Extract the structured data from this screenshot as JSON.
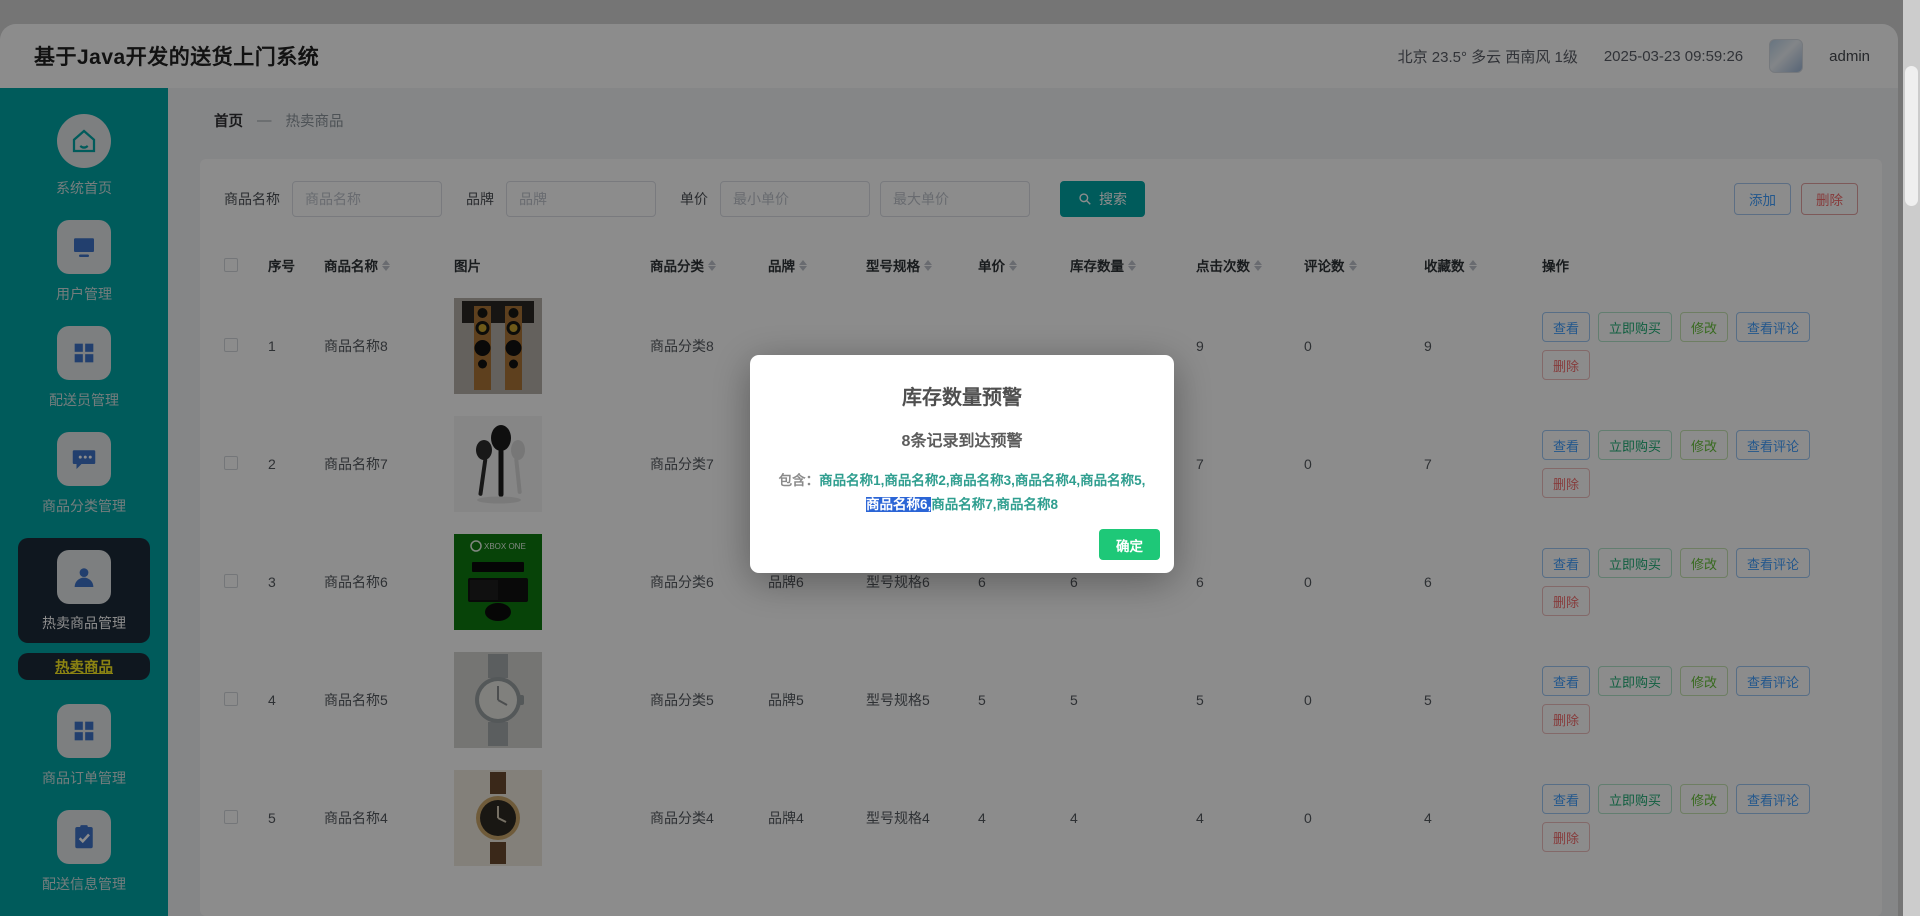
{
  "colors": {
    "teal": "#00a6a6",
    "active_bg": "#1d2a39",
    "submenu_text": "#fdee21",
    "link_blue": "#409eff",
    "danger": "#f56c6c",
    "success": "#1ec878",
    "names_teal": "#2f9e8f",
    "highlight_blue": "#2b65d6"
  },
  "app": {
    "title": "基于Java开发的送货上门系统"
  },
  "topbar": {
    "weather": "北京 23.5° 多云 西南风 1级",
    "datetime": "2025-03-23 09:59:26",
    "username": "admin"
  },
  "sidebar": {
    "items": [
      {
        "label": "系统首页",
        "icon": "home-icon"
      },
      {
        "label": "用户管理",
        "icon": "monitor-icon"
      },
      {
        "label": "配送员管理",
        "icon": "grid-icon"
      },
      {
        "label": "商品分类管理",
        "icon": "chat-icon"
      },
      {
        "label": "热卖商品管理",
        "icon": "user-icon",
        "active": true
      },
      {
        "label": "热卖商品",
        "type": "submenu",
        "active": true
      },
      {
        "label": "商品订单管理",
        "icon": "grid-icon"
      },
      {
        "label": "配送信息管理",
        "icon": "clipboard-check-icon"
      }
    ]
  },
  "breadcrumb": {
    "home": "首页",
    "separator": "—",
    "current": "热卖商品"
  },
  "filters": {
    "name_label": "商品名称",
    "name_placeholder": "商品名称",
    "brand_label": "品牌",
    "brand_placeholder": "品牌",
    "price_label": "单价",
    "price_min_placeholder": "最小单价",
    "price_max_placeholder": "最大单价",
    "search_label": "搜索"
  },
  "toolbar": {
    "add_label": "添加",
    "delete_label": "删除"
  },
  "table": {
    "columns": {
      "index": "序号",
      "name": "商品名称",
      "image": "图片",
      "category": "商品分类",
      "brand": "品牌",
      "model": "型号规格",
      "price": "单价",
      "stock": "库存数量",
      "clicks": "点击次数",
      "comments": "评论数",
      "favorites": "收藏数",
      "ops": "操作"
    },
    "actions": {
      "view": "查看",
      "buy": "立即购买",
      "edit": "修改",
      "comments": "查看评论",
      "delete": "删除"
    },
    "rows": [
      {
        "index": "1",
        "name": "商品名称8",
        "image": "speakers-image",
        "category": "商品分类8",
        "brand": "",
        "model": "",
        "price": "",
        "stock": "",
        "clicks": "9",
        "comments": "0",
        "favorites": "9"
      },
      {
        "index": "2",
        "name": "商品名称7",
        "image": "earbuds-image",
        "category": "商品分类7",
        "brand": "",
        "model": "",
        "price": "",
        "stock": "",
        "clicks": "7",
        "comments": "0",
        "favorites": "7"
      },
      {
        "index": "3",
        "name": "商品名称6",
        "image": "xbox-image",
        "category": "商品分类6",
        "brand": "品牌6",
        "model": "型号规格6",
        "price": "6",
        "stock": "6",
        "clicks": "6",
        "comments": "0",
        "favorites": "6"
      },
      {
        "index": "4",
        "name": "商品名称5",
        "image": "silver-watch-image",
        "category": "商品分类5",
        "brand": "品牌5",
        "model": "型号规格5",
        "price": "5",
        "stock": "5",
        "clicks": "5",
        "comments": "0",
        "favorites": "5"
      },
      {
        "index": "5",
        "name": "商品名称4",
        "image": "brown-watch-image",
        "category": "商品分类4",
        "brand": "品牌4",
        "model": "型号规格4",
        "price": "4",
        "stock": "4",
        "clicks": "4",
        "comments": "0",
        "favorites": "4"
      }
    ]
  },
  "modal": {
    "title": "库存数量预警",
    "subtitle": "8条记录到达预警",
    "contains_label": "包含：",
    "names_part1": "商品名称1,商品名称2,商品名称3,商品名称4,商品名称5,",
    "highlighted_name": "商品名称6,",
    "names_part2": "商品名称7,商品名称8",
    "confirm_label": "确定"
  }
}
